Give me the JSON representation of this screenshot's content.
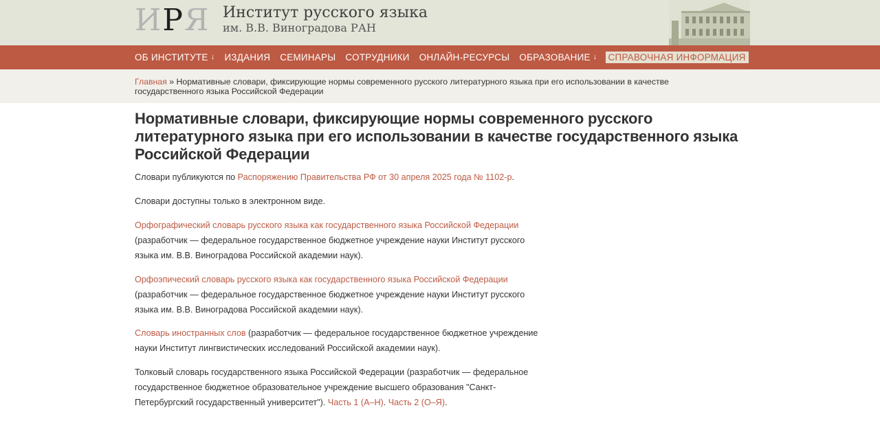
{
  "header": {
    "logo": {
      "l1": "И",
      "l2": "Р",
      "l3": "Я"
    },
    "title": "Институт русского языка",
    "subtitle": "им. В.В. Виноградова РАН"
  },
  "nav": {
    "items": [
      {
        "label": "Об институте",
        "arrow": "↓"
      },
      {
        "label": "Издания",
        "arrow": ""
      },
      {
        "label": "Семинары",
        "arrow": ""
      },
      {
        "label": "Сотрудники",
        "arrow": ""
      },
      {
        "label": "Онлайн-ресурсы",
        "arrow": ""
      },
      {
        "label": "Образование",
        "arrow": "↓"
      },
      {
        "label": "Справочная информация",
        "arrow": ""
      }
    ]
  },
  "breadcrumb": {
    "home": "Главная",
    "separator": " » ",
    "current": "Нормативные словари, фиксирующие нормы современного русского литературного языка при его использовании в качестве государственного языка Российской Федерации"
  },
  "main": {
    "title": "Нормативные словари, фиксирующие нормы современного русского литературного языка при его использовании в качестве государственного языка Российской Федерации",
    "p1_text": "Словари публикуются по ",
    "p1_link": "Распоряжению Правительства РФ от 30 апреля 2025 года № 1102-р",
    "p1_end": ".",
    "p2": "Словари доступны только в электронном виде.",
    "d1_link": "Орфографический словарь русского языка как государственного языка Российской Федерации",
    "d1_text": "(разработчик — федеральное государственное бюджетное учреждение науки Институт русского языка им. В.В. Виноградова Российской академии наук).",
    "d2_link": "Орфоэпический словарь русского языка как государственного языка Российской Федерации",
    "d2_text": "(разработчик — федеральное государственное бюджетное учреждение науки Институт русского языка им. В.В. Виноградова Российской академии наук).",
    "d3_link": "Словарь иностранных слов",
    "d3_text": " (разработчик — федеральное государственное бюджетное учреждение науки Институт лингвистических исследований Российской академии наук).",
    "d4_text": "Толковый словарь государственного языка Российской Федерации (разработчик — федеральное государственное бюджетное образовательное учреждение высшего образования \"Санкт-Петербургский государственный университет\"). ",
    "d4_link1": "Часть 1 (А–Н)",
    "d4_sep": ". ",
    "d4_link2": "Часть 2 (О–Я)",
    "d4_end": "."
  },
  "colors": {
    "accent": "#bd5a43",
    "header_bg": "#e3e5d8",
    "crumb_bg": "#f2f0ea"
  }
}
